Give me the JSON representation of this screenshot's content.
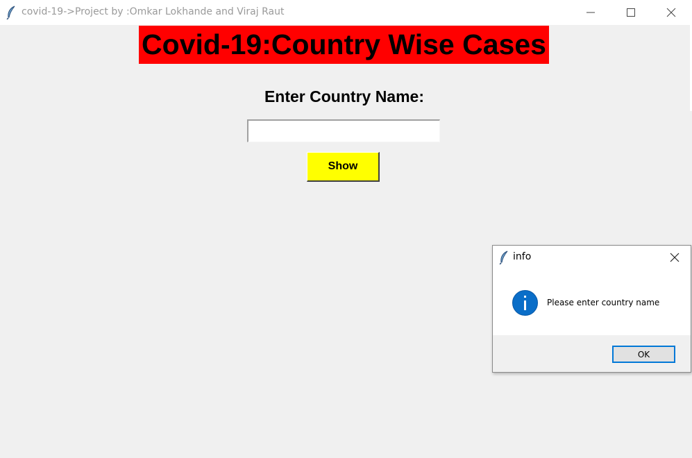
{
  "window": {
    "title": "covid-19->Project by :Omkar Lokhande and Viraj Raut",
    "app_icon": "feather-icon"
  },
  "main": {
    "heading": "Covid-19:Country Wise Cases",
    "prompt": "Enter Country Name:",
    "country_input": {
      "value": "",
      "placeholder": ""
    },
    "show_button": "Show"
  },
  "dialog": {
    "title": "info",
    "icon": "info-icon",
    "message": "Please enter country name",
    "ok_button": "OK"
  },
  "colors": {
    "heading_bg": "#ff0000",
    "button_bg": "#ffff00",
    "window_bg": "#f0f0f0",
    "info_icon": "#0a6ec8",
    "ok_border": "#0078d7"
  }
}
